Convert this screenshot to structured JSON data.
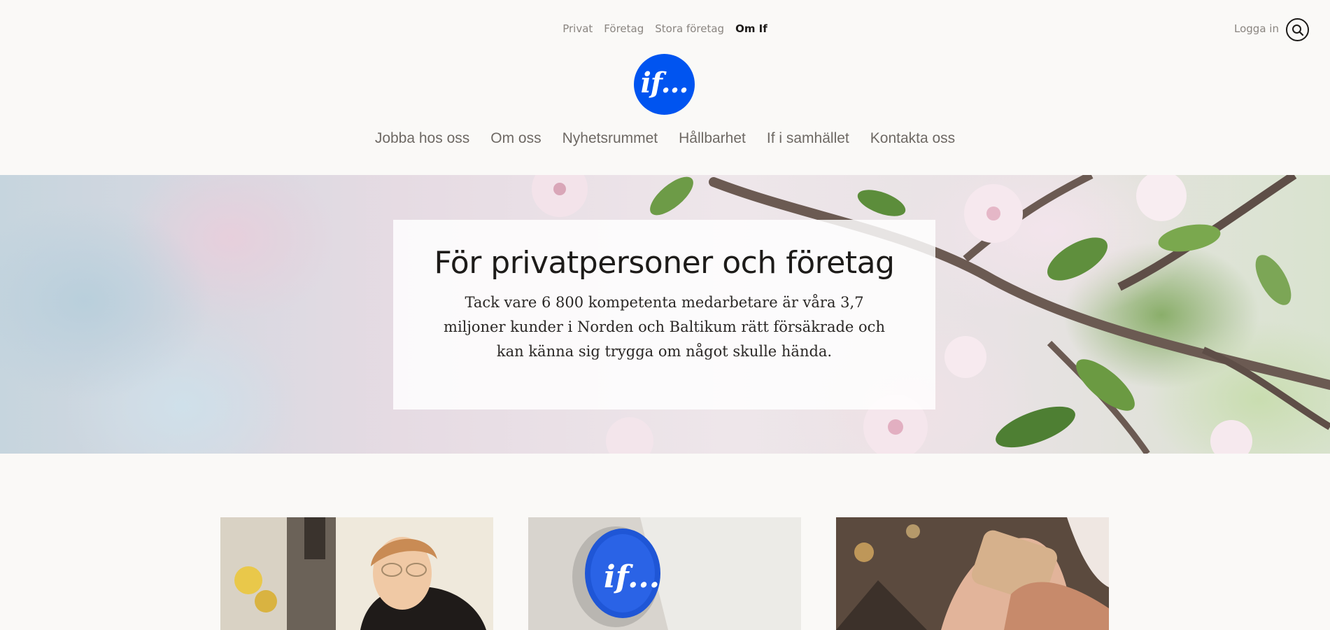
{
  "top_nav": {
    "segments": [
      "Privat",
      "Företag",
      "Stora företag",
      "Om If"
    ],
    "active_segment": "Om If",
    "login_label": "Logga in",
    "search_icon": "search-icon"
  },
  "logo": {
    "text": "if...",
    "color": "#0054f0"
  },
  "main_nav": {
    "items": [
      "Jobba hos oss",
      "Om oss",
      "Nyhetsrummet",
      "Hållbarhet",
      "If i samhället",
      "Kontakta oss"
    ]
  },
  "hero": {
    "title": "För privatpersoner och företag",
    "text": "Tack vare 6 800 kompetenta medarbetare är våra 3,7 miljoner kunder i Norden och Baltikum rätt försäkrade och kan känna sig trygga om något skulle hända."
  },
  "cards": [
    {
      "image": "woman-smiling-photo"
    },
    {
      "image": "if-sign-photo"
    },
    {
      "image": "hands-phone-photo"
    }
  ],
  "colors": {
    "brand_blue": "#0054f0",
    "background": "#faf9f7",
    "nav_text": "#6e6964"
  }
}
